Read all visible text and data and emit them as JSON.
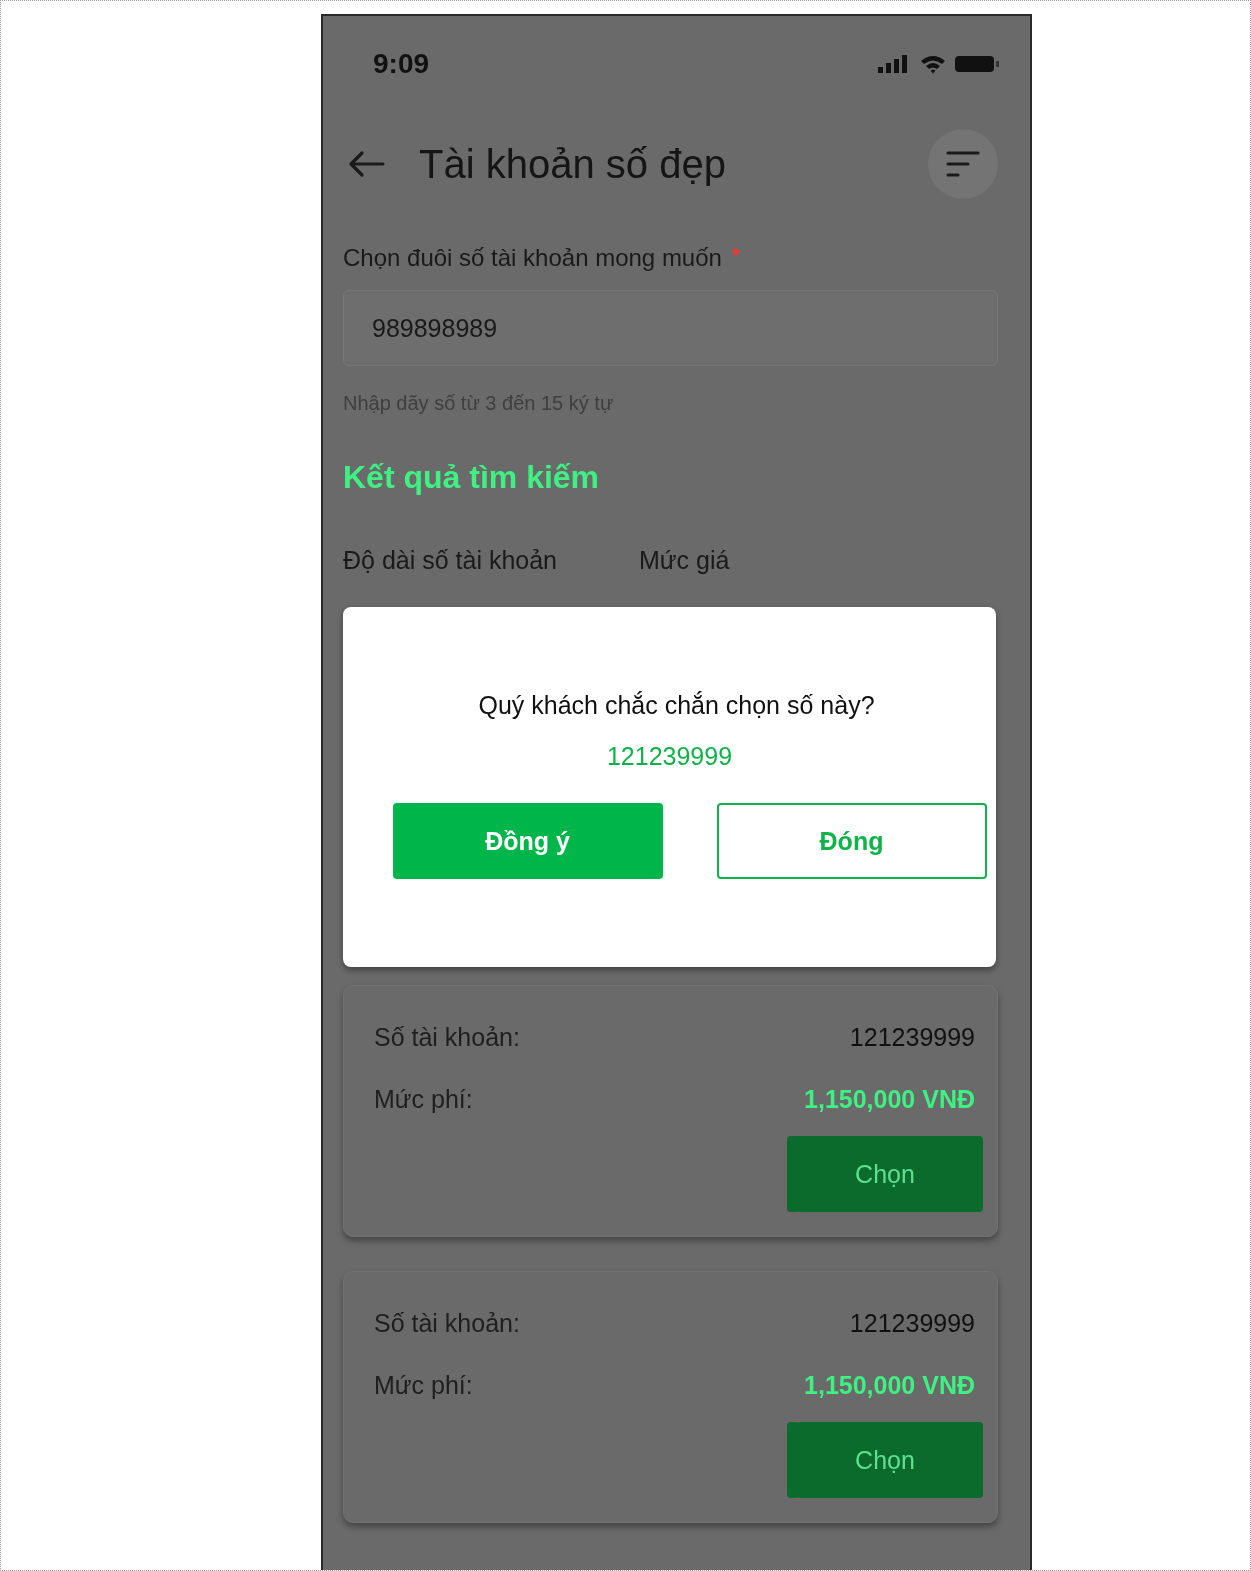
{
  "status_bar": {
    "time": "9:09"
  },
  "header": {
    "title": "Tài khoản số đẹp"
  },
  "field": {
    "label": "Chọn đuôi số tài khoản mong muốn",
    "required": true,
    "required_mark": "*",
    "value": "989898989",
    "hint": "Nhập dãy số từ 3 đến 15 ký tự"
  },
  "results_title": "Kết quả tìm kiếm",
  "filters": [
    "Độ dài số tài khoản",
    "Mức giá"
  ],
  "accounts": [
    {
      "account_label": "Số tài khoản:",
      "account": "121239999",
      "fee_label": "Mức phí:",
      "fee": "1,150,000 VNĐ",
      "button": "Chọn"
    },
    {
      "account_label": "Số tài khoản:",
      "account": "121239999",
      "fee_label": "Mức phí:",
      "fee": "1,150,000 VNĐ",
      "button": "Chọn"
    }
  ],
  "dialog": {
    "question": "Quý khách chắc chắn chọn số này?",
    "number": "121239999",
    "buttons": [
      {
        "label": "Đồng ý",
        "kind": "primary"
      },
      {
        "label": "Đóng",
        "kind": "secondary"
      }
    ]
  }
}
